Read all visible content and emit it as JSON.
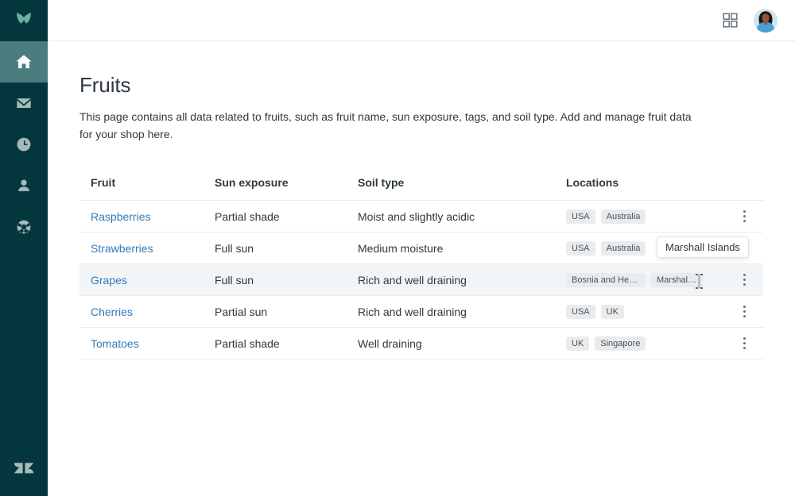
{
  "sidebar": {
    "logo_icon": "leaf-logo",
    "items": [
      {
        "icon": "home-icon",
        "name": "home",
        "active": true
      },
      {
        "icon": "mail-icon",
        "name": "mail",
        "active": false
      },
      {
        "icon": "clock-icon",
        "name": "clock",
        "active": false
      },
      {
        "icon": "person-icon",
        "name": "person",
        "active": false
      },
      {
        "icon": "lifebuoy-icon",
        "name": "support",
        "active": false
      }
    ],
    "footer_icon": "zendesk-logo",
    "background_color": "#03363d",
    "active_color": "#4a7c7e",
    "icon_color": "#a6b9bb",
    "logo_color": "#78a300"
  },
  "topbar": {
    "apps_icon": "grid-apps-icon",
    "avatar": "user-avatar"
  },
  "page": {
    "title": "Fruits",
    "description": "This page contains all data related to fruits, such as fruit name, sun exposure, tags, and soil type. Add and manage fruit data for your shop here."
  },
  "table": {
    "columns": [
      "Fruit",
      "Sun exposure",
      "Soil type",
      "Locations"
    ],
    "menu_icon": "kebab-menu-icon",
    "rows": [
      {
        "fruit": "Raspberries",
        "sun_exposure": "Partial shade",
        "soil_type": "Moist and slightly acidic",
        "locations": [
          "USA",
          "Australia"
        ],
        "hovered": false
      },
      {
        "fruit": "Strawberries",
        "sun_exposure": "Full sun",
        "soil_type": "Medium moisture",
        "locations": [
          "USA",
          "Australia"
        ],
        "hovered": false
      },
      {
        "fruit": "Grapes",
        "sun_exposure": "Full sun",
        "soil_type": "Rich and well draining",
        "locations": [
          "Bosnia and Herzegovina",
          "Marshall I..."
        ],
        "hovered": true
      },
      {
        "fruit": "Cherries",
        "sun_exposure": "Partial sun",
        "soil_type": "Rich and well draining",
        "locations": [
          "USA",
          "UK"
        ],
        "hovered": false
      },
      {
        "fruit": "Tomatoes",
        "sun_exposure": "Partial shade",
        "soil_type": "Well draining",
        "locations": [
          "UK",
          "Singapore"
        ],
        "hovered": false
      }
    ]
  },
  "tooltip": {
    "text": "Marshall Islands"
  },
  "colors": {
    "link": "#337ab7",
    "text": "#2f3941",
    "tag_bg": "#e9ebed",
    "tag_text": "#49545c",
    "row_hover": "#f2f5f7",
    "border": "#e9ebed"
  }
}
